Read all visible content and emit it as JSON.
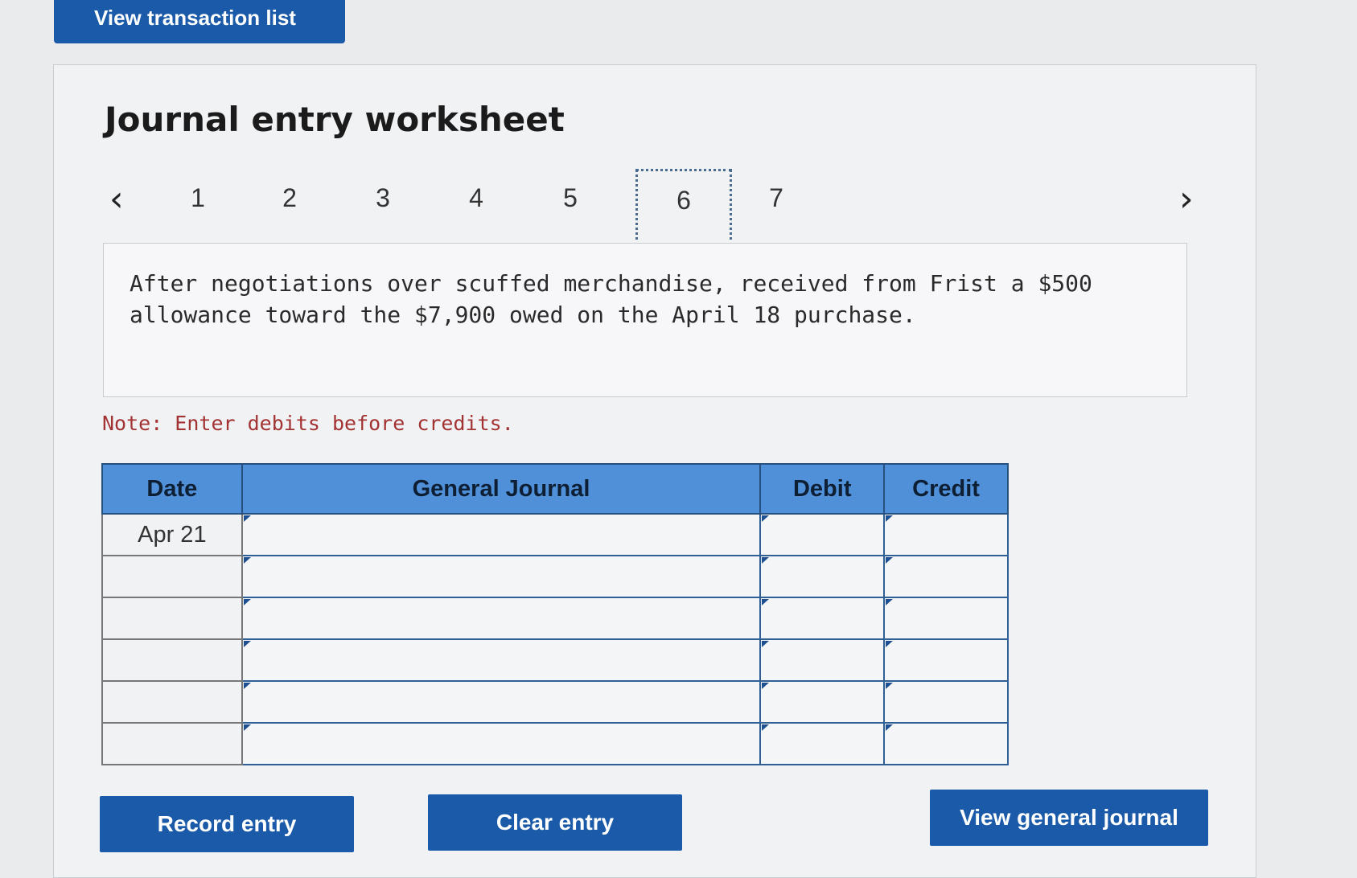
{
  "header": {
    "view_transactions_label": "View transaction list"
  },
  "worksheet": {
    "title": "Journal entry worksheet",
    "pager": {
      "prev_icon": "‹",
      "next_icon": "›",
      "pages": [
        "1",
        "2",
        "3",
        "4",
        "5",
        "6",
        "7"
      ],
      "active_page": "6"
    },
    "description": "After negotiations over scuffed merchandise, received from Frist a $500 allowance toward the $7,900 owed on the April 18 purchase.",
    "note": "Note: Enter debits before credits."
  },
  "journal_table": {
    "headers": {
      "date": "Date",
      "general_journal": "General Journal",
      "debit": "Debit",
      "credit": "Credit"
    },
    "rows": [
      {
        "date": "Apr 21",
        "account": "",
        "debit": "",
        "credit": ""
      },
      {
        "date": "",
        "account": "",
        "debit": "",
        "credit": ""
      },
      {
        "date": "",
        "account": "",
        "debit": "",
        "credit": ""
      },
      {
        "date": "",
        "account": "",
        "debit": "",
        "credit": ""
      },
      {
        "date": "",
        "account": "",
        "debit": "",
        "credit": ""
      },
      {
        "date": "",
        "account": "",
        "debit": "",
        "credit": ""
      }
    ]
  },
  "actions": {
    "record_label": "Record entry",
    "clear_label": "Clear entry",
    "view_general_journal_label": "View general journal"
  },
  "colors": {
    "primary_button": "#1a5aa8",
    "table_header": "#4f90d8",
    "note_text": "#a33232"
  }
}
